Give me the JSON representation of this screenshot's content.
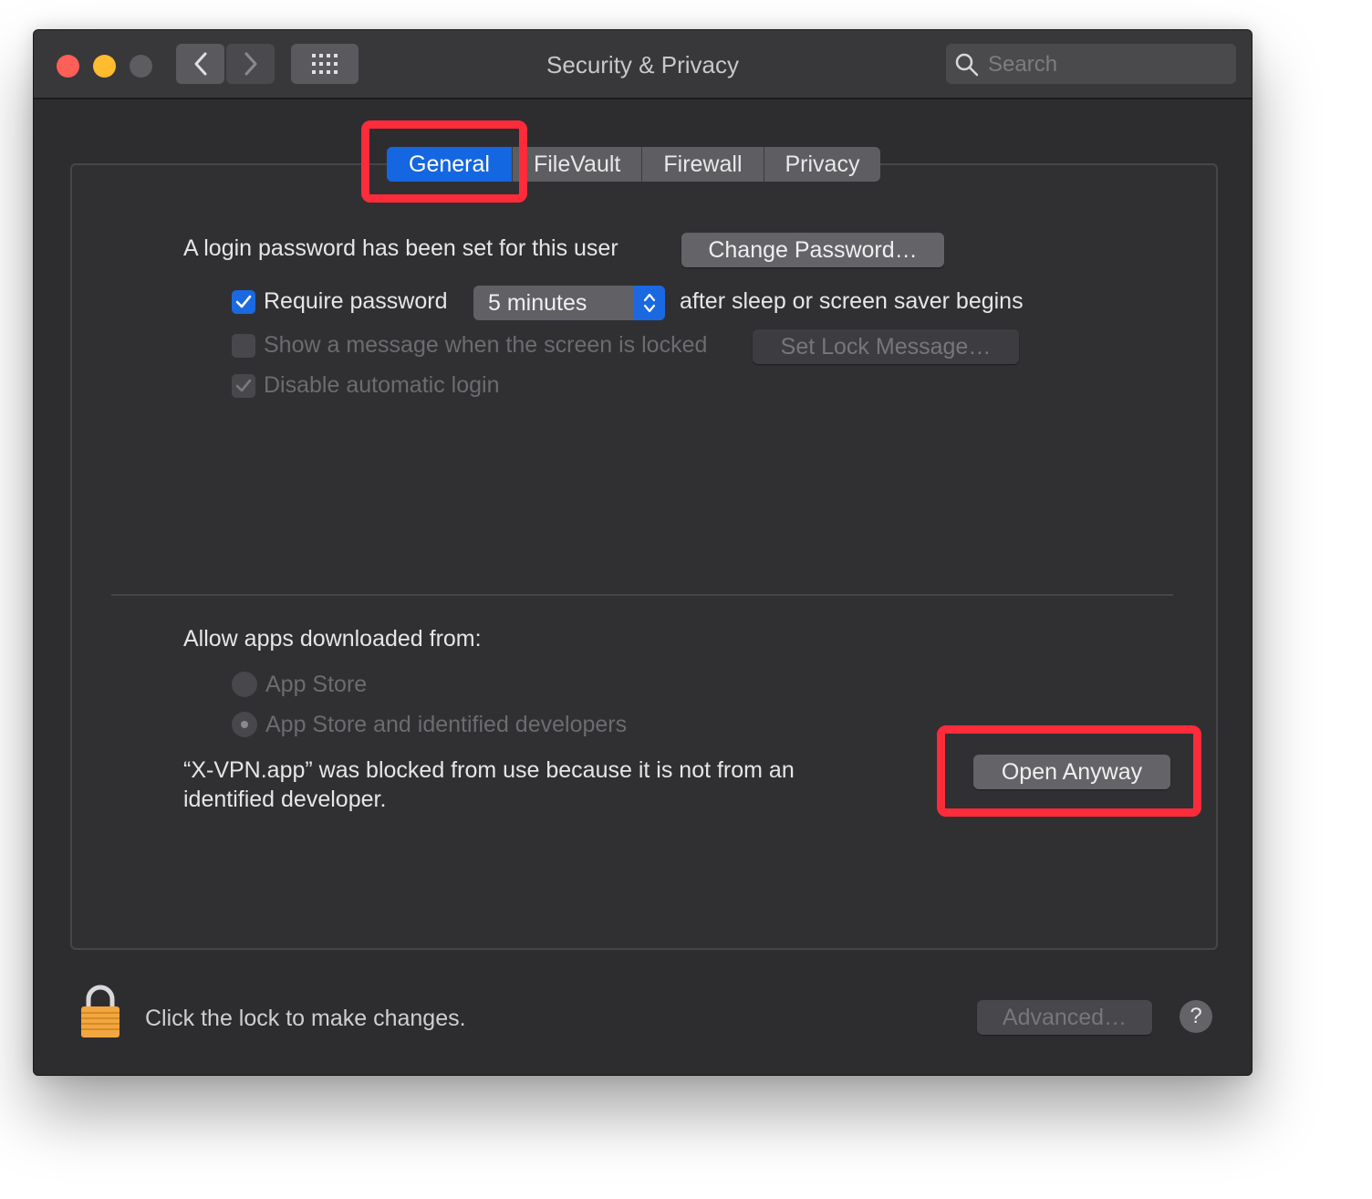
{
  "window": {
    "title": "Security & Privacy"
  },
  "search": {
    "placeholder": "Search"
  },
  "tabs": [
    {
      "label": "General",
      "active": true
    },
    {
      "label": "FileVault",
      "active": false
    },
    {
      "label": "Firewall",
      "active": false
    },
    {
      "label": "Privacy",
      "active": false
    }
  ],
  "general": {
    "login_text": "A login password has been set for this user",
    "change_password_label": "Change Password…",
    "require_password_label": "Require password",
    "require_password_checked": true,
    "require_password_value": "5 minutes",
    "after_sleep_text": "after sleep or screen saver begins",
    "show_message_label": "Show a message when the screen is locked",
    "show_message_checked": false,
    "set_lock_message_label": "Set Lock Message…",
    "disable_autologin_label": "Disable automatic login",
    "disable_autologin_checked": true
  },
  "allow_apps": {
    "heading": "Allow apps downloaded from:",
    "options": [
      {
        "label": "App Store",
        "selected": false
      },
      {
        "label": "App Store and identified developers",
        "selected": true
      }
    ],
    "blocked_message_line1": "“X-VPN.app” was blocked from use because it is not from an",
    "blocked_message_line2": "identified developer.",
    "open_anyway_label": "Open Anyway"
  },
  "footer": {
    "lock_text": "Click the lock to make changes.",
    "advanced_label": "Advanced…",
    "help_label": "?"
  },
  "colors": {
    "accent": "#1467e0",
    "annotation": "#fe2b3a",
    "lock": "#f2a641"
  }
}
